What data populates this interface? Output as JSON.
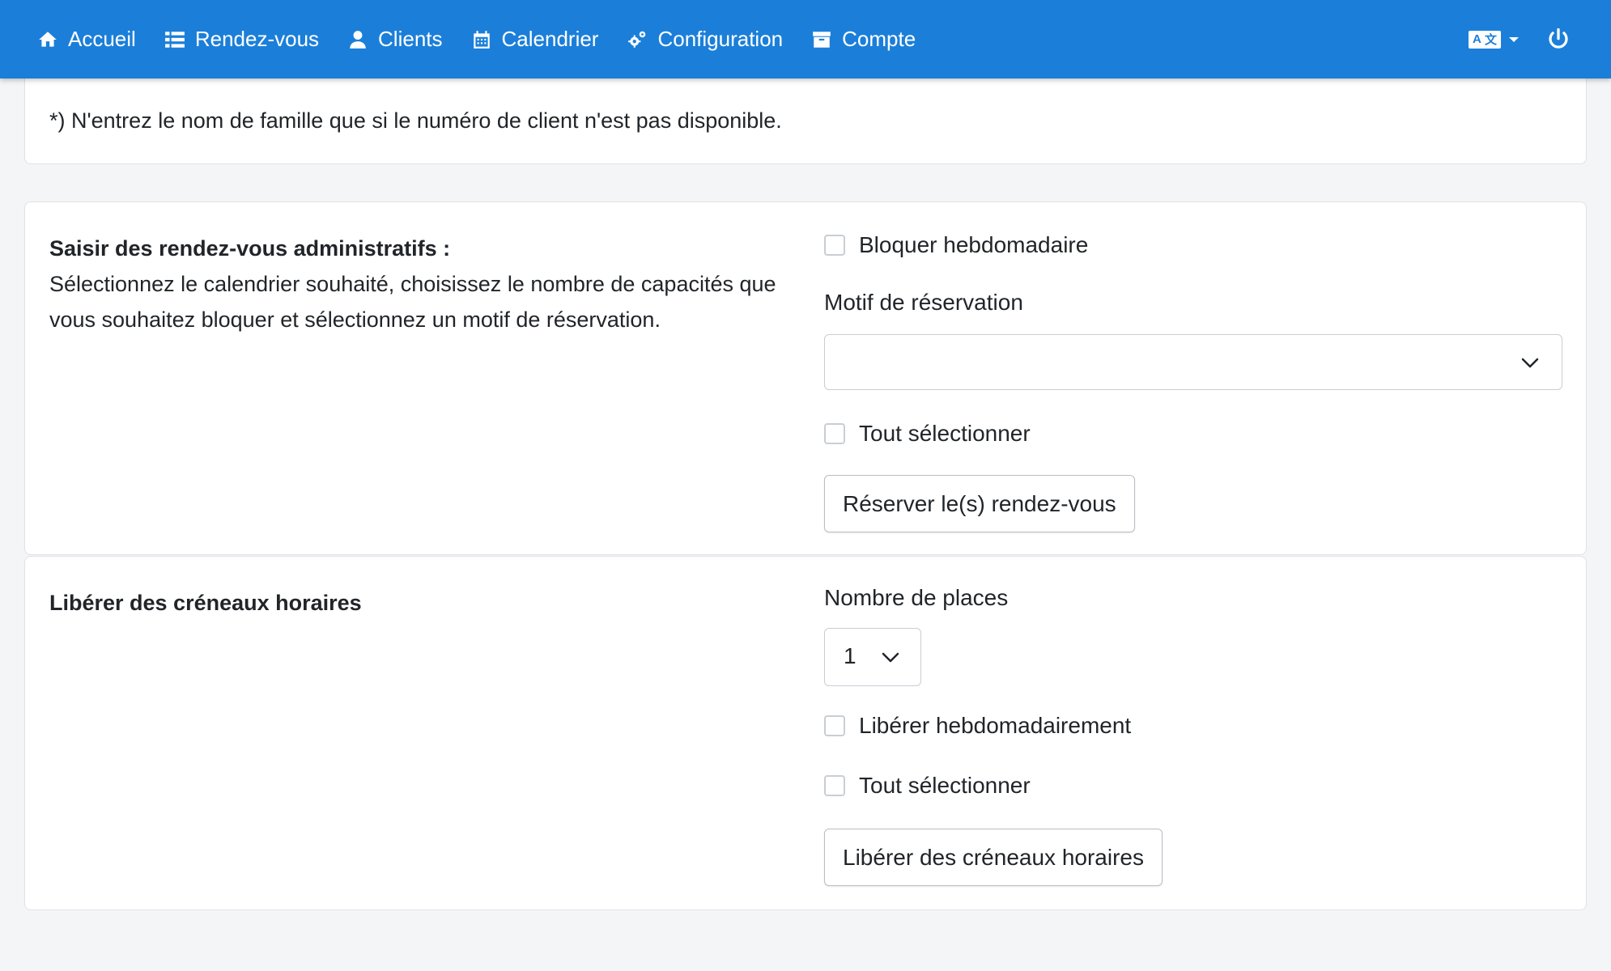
{
  "nav": {
    "items": [
      {
        "label": "Accueil",
        "icon": "home-icon"
      },
      {
        "label": "Rendez-vous",
        "icon": "list-icon"
      },
      {
        "label": "Clients",
        "icon": "user-icon"
      },
      {
        "label": "Calendrier",
        "icon": "calendar-icon"
      },
      {
        "label": "Configuration",
        "icon": "cogs-icon"
      },
      {
        "label": "Compte",
        "icon": "archive-icon"
      }
    ],
    "language_icon": "translate-icon",
    "power_icon": "power-icon",
    "bg_color": "#1b7fd9"
  },
  "note": {
    "text": "*) N'entrez le nom de famille que si le numéro de client n'est pas disponible."
  },
  "admin_block": {
    "title": "Saisir des rendez-vous administratifs :",
    "description": "Sélectionnez le calendrier souhaité, choisissez le nombre de capacités que vous souhaitez bloquer et sélectionnez un motif de réservation.",
    "weekly_label": "Bloquer hebdomadaire",
    "reason_label": "Motif de réservation",
    "reason_value": "",
    "select_all_label": "Tout sélectionner",
    "submit_label": "Réserver le(s) rendez-vous"
  },
  "release_block": {
    "title": "Libérer des créneaux horaires",
    "places_label": "Nombre de places",
    "places_value": "1",
    "weekly_label": "Libérer hebdomadairement",
    "select_all_label": "Tout sélectionner",
    "submit_label": "Libérer des créneaux horaires"
  }
}
